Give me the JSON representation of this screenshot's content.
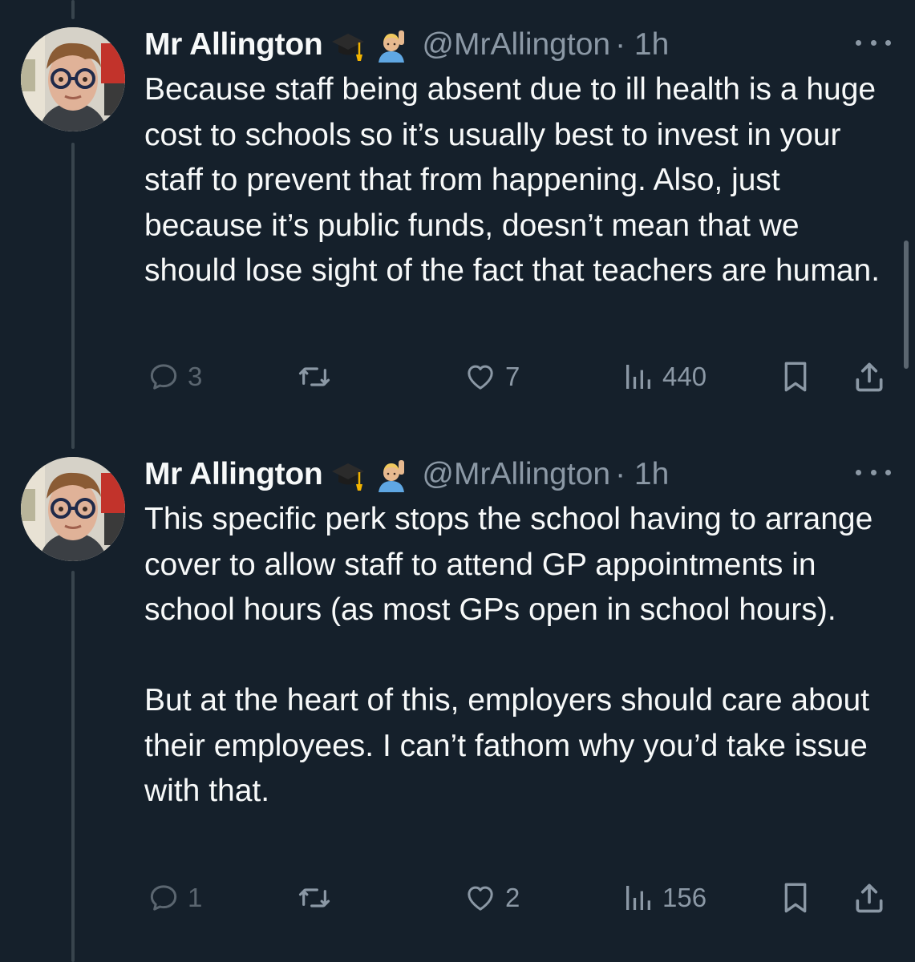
{
  "tweets": [
    {
      "author_name": "Mr Allington",
      "handle": "@MrAllington",
      "time": "· 1h",
      "badge_icons": [
        "graduation-cap-emoji",
        "person-raising-hand-emoji"
      ],
      "body": [
        "Because staff being absent due to ill health is a huge cost to schools so it’s usually best to invest in your staff to prevent that from happening. Also, just because it’s public funds, doesn’t mean that we should lose sight of the fact that teachers are human."
      ],
      "replies": "3",
      "likes": "7",
      "views": "440"
    },
    {
      "author_name": "Mr Allington",
      "handle": "@MrAllington",
      "time": "· 1h",
      "badge_icons": [
        "graduation-cap-emoji",
        "person-raising-hand-emoji"
      ],
      "body": [
        "This specific perk stops the school having to arrange cover to allow staff to attend GP appointments in school hours (as most GPs open in school hours).",
        "But at the heart of this, employers should care about their employees. I can’t fathom why you’d take issue with that."
      ],
      "replies": "1",
      "likes": "2",
      "views": "156"
    }
  ],
  "icons": {
    "reply": "reply-icon",
    "retweet": "retweet-icon",
    "like": "heart-icon",
    "views": "views-chart-icon",
    "bookmark": "bookmark-icon",
    "share": "share-icon",
    "more": "more-dots-icon"
  },
  "colors": {
    "background": "#15202b",
    "text": "#f7f9f9",
    "secondary": "#8b98a5",
    "thread_line": "#38444d"
  }
}
